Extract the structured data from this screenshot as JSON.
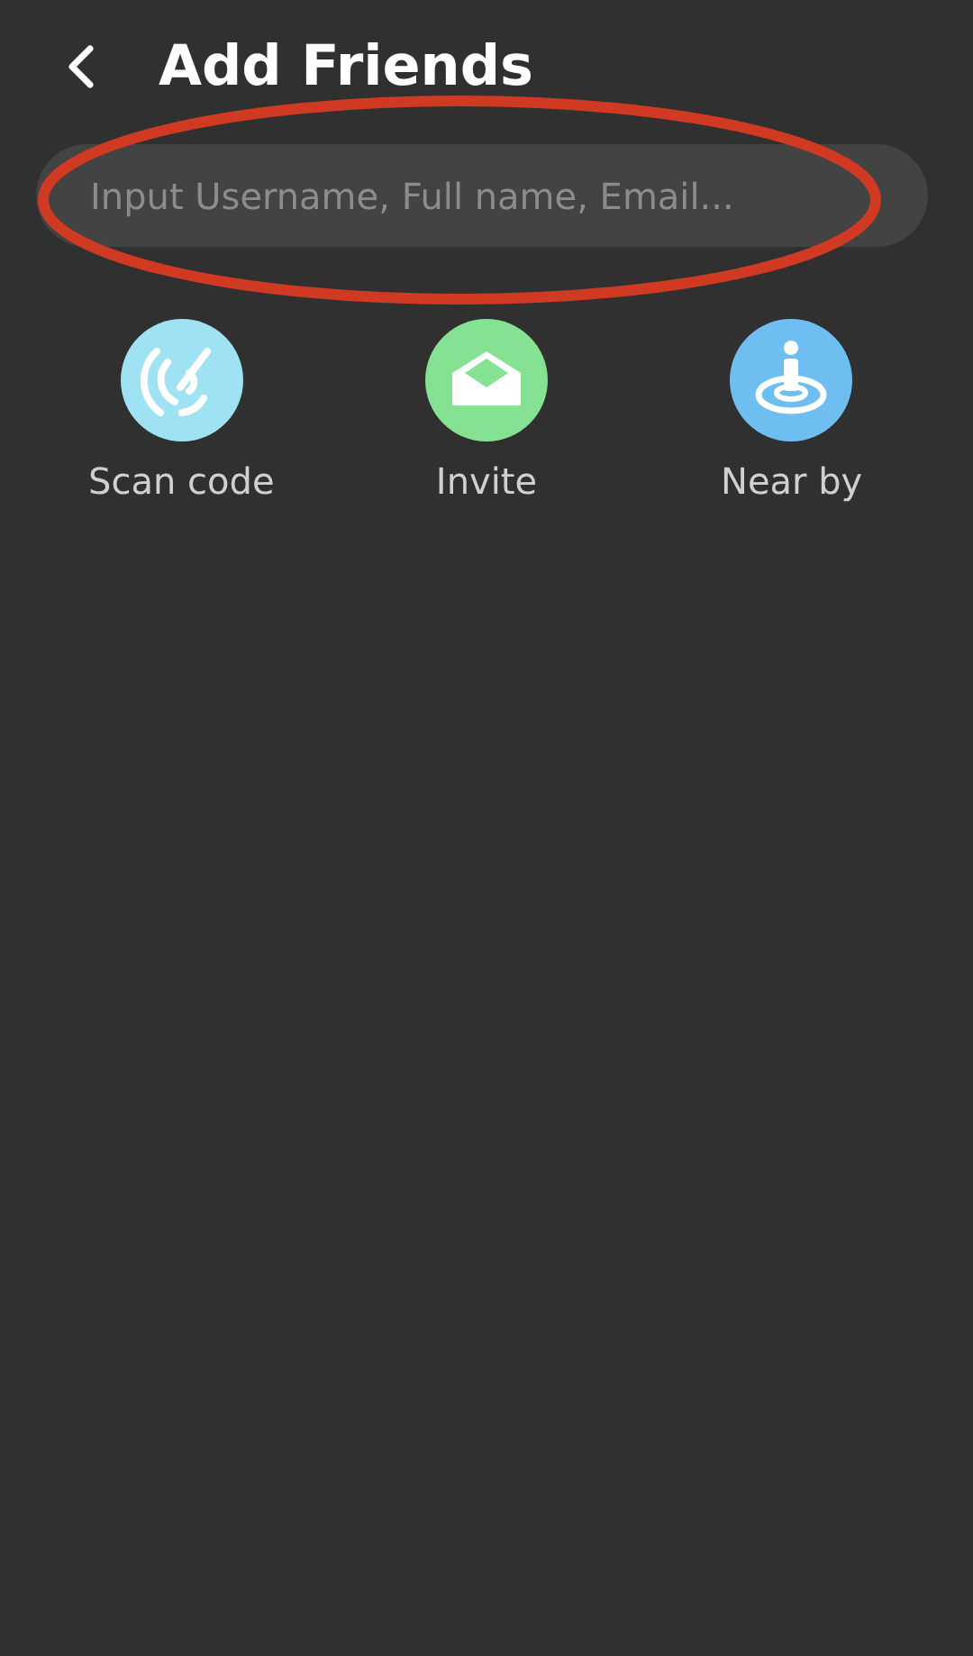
{
  "header": {
    "title": "Add Friends"
  },
  "search": {
    "placeholder": "Input Username, Full name, Email...",
    "highlighted": true
  },
  "actions": [
    {
      "kind": "scan",
      "label": "Scan code",
      "color": "#9fe2f3"
    },
    {
      "kind": "invite",
      "label": "Invite",
      "color": "#86e293"
    },
    {
      "kind": "nearby",
      "label": "Near by",
      "color": "#6fbef2"
    }
  ]
}
